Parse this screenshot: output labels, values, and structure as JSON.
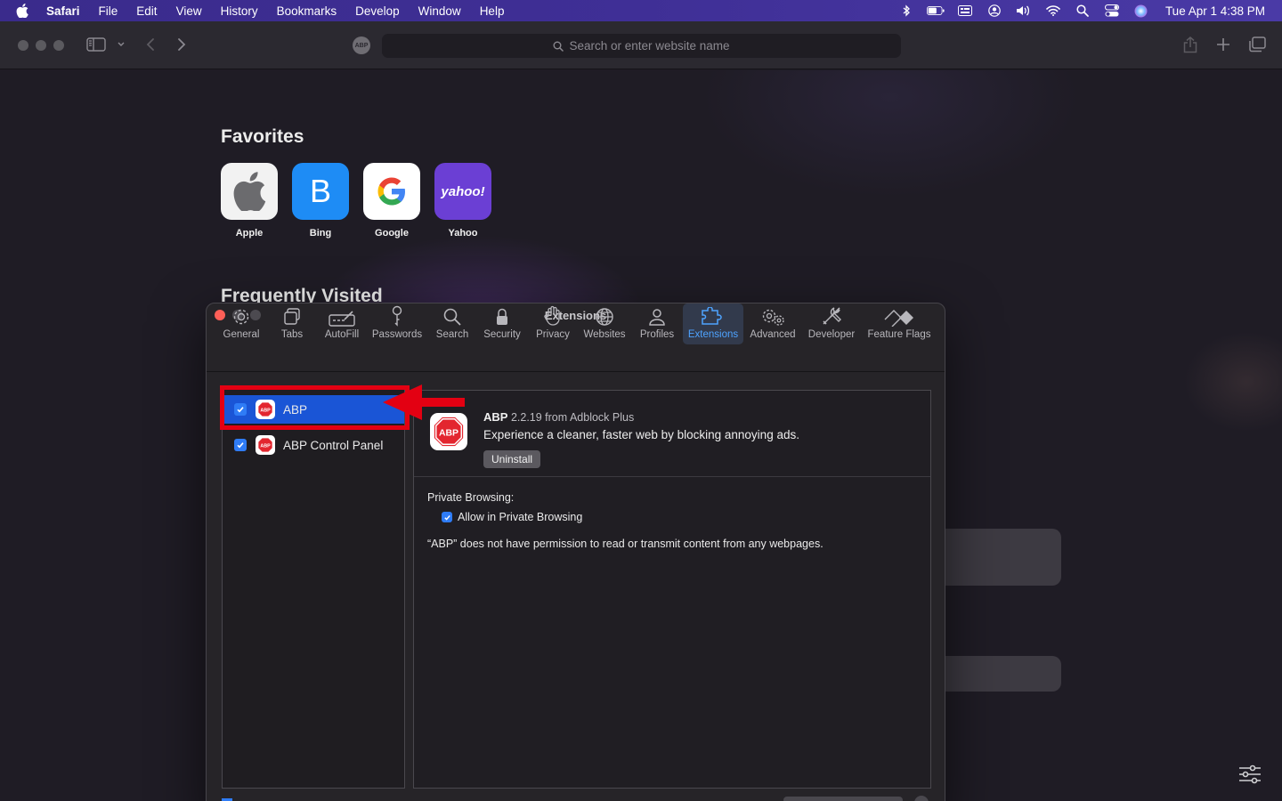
{
  "menubar": {
    "app": "Safari",
    "items": [
      "File",
      "Edit",
      "View",
      "History",
      "Bookmarks",
      "Develop",
      "Window",
      "Help"
    ],
    "clock": "Tue Apr 1  4:38 PM",
    "status_icons": [
      "bluetooth-icon",
      "battery-icon",
      "keyboard-input-icon",
      "user-account-icon",
      "volume-icon",
      "wifi-icon",
      "spotlight-search-icon",
      "control-center-icon",
      "siri-icon"
    ]
  },
  "toolbar": {
    "address_placeholder": "Search or enter website name",
    "abp_badge": "ABP"
  },
  "startpage": {
    "favorites_title": "Favorites",
    "favorites": [
      {
        "name": "Apple",
        "letter": "",
        "bg": "#f2f2f2"
      },
      {
        "name": "Bing",
        "letter": "B",
        "bg": "#1e8cf5"
      },
      {
        "name": "Google",
        "letter": "G",
        "bg": "#ffffff"
      },
      {
        "name": "Yahoo",
        "letter": "yahoo!",
        "bg": "#6b3fd4"
      }
    ],
    "frequently_visited_title": "Frequently Visited"
  },
  "prefs": {
    "title": "Extensions",
    "tabs": [
      "General",
      "Tabs",
      "AutoFill",
      "Passwords",
      "Search",
      "Security",
      "Privacy",
      "Websites",
      "Profiles",
      "Extensions",
      "Advanced",
      "Developer",
      "Feature Flags"
    ],
    "active_tab": "Extensions",
    "extensions": [
      {
        "name": "ABP",
        "enabled": true,
        "selected": true
      },
      {
        "name": "ABP Control Panel",
        "enabled": true,
        "selected": false
      }
    ],
    "detail": {
      "name": "ABP",
      "version": "2.2.19 from Adblock Plus",
      "description": "Experience a cleaner, faster web by blocking annoying ads.",
      "uninstall_label": "Uninstall",
      "private_browsing_title": "Private Browsing:",
      "private_browsing_option": "Allow in Private Browsing",
      "private_browsing_allowed": true,
      "permission_text": "“ABP” does not have permission to read or transmit content from any webpages."
    },
    "logo_text": "ABP"
  },
  "colors": {
    "accent": "#1a55d6",
    "highlight_red": "#e30012",
    "menubar": "#3f2f96"
  }
}
